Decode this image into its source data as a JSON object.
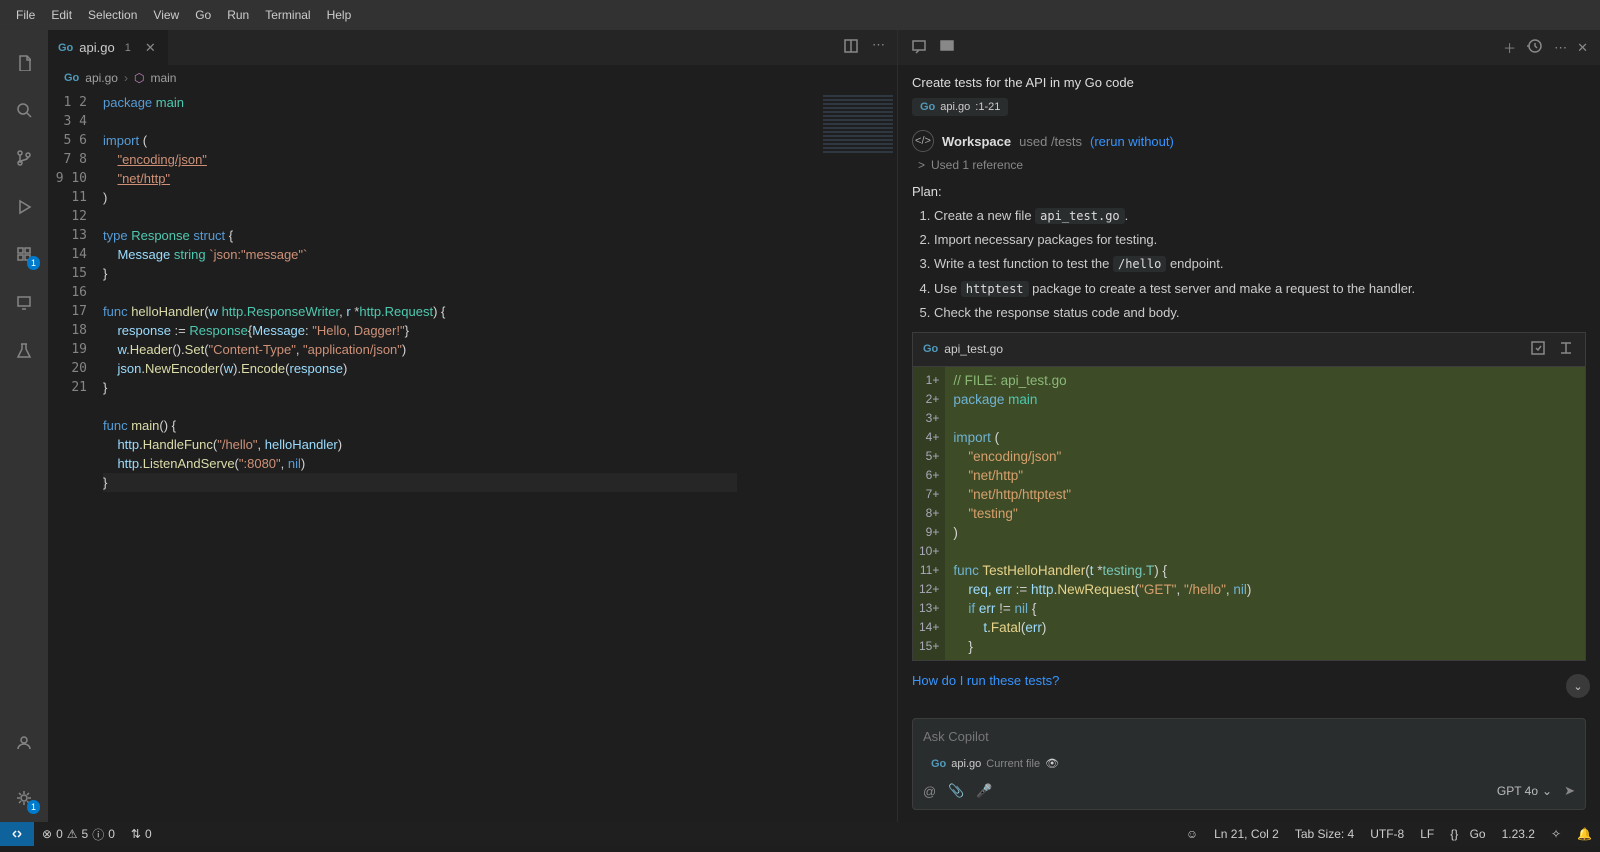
{
  "menubar": [
    "File",
    "Edit",
    "Selection",
    "View",
    "Go",
    "Run",
    "Terminal",
    "Help"
  ],
  "tab": {
    "icon": "go",
    "name": "api.go",
    "dirty": "1"
  },
  "tab_actions": {
    "split": "split-icon",
    "more": "more-icon"
  },
  "breadcrumb": {
    "icon": "go",
    "file": "api.go",
    "sym_icon": "package-icon",
    "sym": "main"
  },
  "editor": {
    "line_count": 21,
    "lines": [
      [
        [
          "kw",
          "package"
        ],
        [
          "sp",
          " "
        ],
        [
          "pkg",
          "main"
        ]
      ],
      [],
      [
        [
          "kw",
          "import"
        ],
        [
          "sp",
          " "
        ],
        [
          "punc",
          "("
        ]
      ],
      [
        [
          "sp",
          "    "
        ],
        [
          "str-u",
          "\"encoding/json\""
        ]
      ],
      [
        [
          "sp",
          "    "
        ],
        [
          "str-u",
          "\"net/http\""
        ]
      ],
      [
        [
          "punc",
          ")"
        ]
      ],
      [],
      [
        [
          "kw",
          "type"
        ],
        [
          "sp",
          " "
        ],
        [
          "type",
          "Response"
        ],
        [
          "sp",
          " "
        ],
        [
          "kw",
          "struct"
        ],
        [
          "sp",
          " "
        ],
        [
          "punc",
          "{"
        ]
      ],
      [
        [
          "sp",
          "    "
        ],
        [
          "id",
          "Message"
        ],
        [
          "sp",
          " "
        ],
        [
          "type",
          "string"
        ],
        [
          "sp",
          " "
        ],
        [
          "tag",
          "`json:\"message\"`"
        ]
      ],
      [
        [
          "punc",
          "}"
        ]
      ],
      [],
      [
        [
          "kw",
          "func"
        ],
        [
          "sp",
          " "
        ],
        [
          "fn",
          "helloHandler"
        ],
        [
          "punc",
          "("
        ],
        [
          "id",
          "w"
        ],
        [
          "sp",
          " "
        ],
        [
          "type",
          "http.ResponseWriter"
        ],
        [
          "punc",
          ", "
        ],
        [
          "id",
          "r"
        ],
        [
          "sp",
          " *"
        ],
        [
          "type",
          "http.Request"
        ],
        [
          "punc",
          ") {"
        ]
      ],
      [
        [
          "sp",
          "    "
        ],
        [
          "id",
          "response"
        ],
        [
          "sp",
          " := "
        ],
        [
          "type",
          "Response"
        ],
        [
          "punc",
          "{"
        ],
        [
          "id",
          "Message"
        ],
        [
          "punc",
          ": "
        ],
        [
          "str",
          "\"Hello, Dagger!\""
        ],
        [
          "punc",
          "}"
        ]
      ],
      [
        [
          "sp",
          "    "
        ],
        [
          "id",
          "w"
        ],
        [
          "punc",
          "."
        ],
        [
          "fn",
          "Header"
        ],
        [
          "punc",
          "()."
        ],
        [
          "fn",
          "Set"
        ],
        [
          "punc",
          "("
        ],
        [
          "str",
          "\"Content-Type\""
        ],
        [
          "punc",
          ", "
        ],
        [
          "str",
          "\"application/json\""
        ],
        [
          "punc",
          ")"
        ]
      ],
      [
        [
          "sp",
          "    "
        ],
        [
          "id",
          "json"
        ],
        [
          "punc",
          "."
        ],
        [
          "fn",
          "NewEncoder"
        ],
        [
          "punc",
          "("
        ],
        [
          "id",
          "w"
        ],
        [
          "punc",
          ")."
        ],
        [
          "fn",
          "Encode"
        ],
        [
          "punc",
          "("
        ],
        [
          "id",
          "response"
        ],
        [
          "punc",
          ")"
        ]
      ],
      [
        [
          "punc",
          "}"
        ]
      ],
      [],
      [
        [
          "kw",
          "func"
        ],
        [
          "sp",
          " "
        ],
        [
          "fn",
          "main"
        ],
        [
          "punc",
          "() {"
        ]
      ],
      [
        [
          "sp",
          "    "
        ],
        [
          "id",
          "http"
        ],
        [
          "punc",
          "."
        ],
        [
          "fn",
          "HandleFunc"
        ],
        [
          "punc",
          "("
        ],
        [
          "str",
          "\"/hello\""
        ],
        [
          "punc",
          ", "
        ],
        [
          "id",
          "helloHandler"
        ],
        [
          "punc",
          ")"
        ]
      ],
      [
        [
          "sp",
          "    "
        ],
        [
          "id",
          "http"
        ],
        [
          "punc",
          "."
        ],
        [
          "fn",
          "ListenAndServe"
        ],
        [
          "punc",
          "("
        ],
        [
          "str",
          "\":8080\""
        ],
        [
          "punc",
          ", "
        ],
        [
          "const",
          "nil"
        ],
        [
          "punc",
          ")"
        ]
      ],
      [
        [
          "punc",
          "}"
        ]
      ]
    ],
    "current_line": 21
  },
  "copilot": {
    "prompt": "Create tests for the API in my Go code",
    "context_chip": {
      "file": "api.go",
      "range": ":1-21"
    },
    "workspace": {
      "label": "Workspace",
      "note": "used /tests",
      "link": "(rerun without)"
    },
    "references": {
      "chev": ">",
      "text": "Used 1 reference"
    },
    "plan_header": "Plan:",
    "plan": [
      {
        "pre": "Create a new file ",
        "code": "api_test.go",
        "post": "."
      },
      {
        "pre": "Import necessary packages for testing.",
        "code": "",
        "post": ""
      },
      {
        "pre": "Write a test function to test the ",
        "code": "/hello",
        "post": " endpoint."
      },
      {
        "pre": "Use ",
        "code": "httptest",
        "post": " package to create a test server and make a request to the handler."
      },
      {
        "pre": "Check the response status code and body.",
        "code": "",
        "post": ""
      }
    ],
    "codeblock": {
      "filename": "api_test.go",
      "lines": [
        {
          "n": "1",
          "mk": "+",
          "tokens": [
            [
              "comment",
              "// FILE: api_test.go"
            ]
          ]
        },
        {
          "n": "2",
          "mk": "+",
          "tokens": [
            [
              "kw",
              "package"
            ],
            [
              "sp",
              " "
            ],
            [
              "pkg",
              "main"
            ]
          ]
        },
        {
          "n": "3",
          "mk": "+",
          "tokens": []
        },
        {
          "n": "4",
          "mk": "+",
          "tokens": [
            [
              "kw",
              "import"
            ],
            [
              "sp",
              " "
            ],
            [
              "punc",
              "("
            ]
          ]
        },
        {
          "n": "5",
          "mk": "+",
          "tokens": [
            [
              "sp",
              "    "
            ],
            [
              "str",
              "\"encoding/json\""
            ]
          ]
        },
        {
          "n": "6",
          "mk": "+",
          "tokens": [
            [
              "sp",
              "    "
            ],
            [
              "str",
              "\"net/http\""
            ]
          ]
        },
        {
          "n": "7",
          "mk": "+",
          "tokens": [
            [
              "sp",
              "    "
            ],
            [
              "str",
              "\"net/http/httptest\""
            ]
          ]
        },
        {
          "n": "8",
          "mk": "+",
          "tokens": [
            [
              "sp",
              "    "
            ],
            [
              "str",
              "\"testing\""
            ]
          ]
        },
        {
          "n": "9",
          "mk": "+",
          "tokens": [
            [
              "punc",
              ")"
            ]
          ]
        },
        {
          "n": "10",
          "mk": "+",
          "tokens": []
        },
        {
          "n": "11",
          "mk": "+",
          "tokens": [
            [
              "kw",
              "func"
            ],
            [
              "sp",
              " "
            ],
            [
              "fn",
              "TestHelloHandler"
            ],
            [
              "punc",
              "("
            ],
            [
              "id",
              "t"
            ],
            [
              "sp",
              " *"
            ],
            [
              "type",
              "testing.T"
            ],
            [
              "punc",
              ") {"
            ]
          ]
        },
        {
          "n": "12",
          "mk": "+",
          "tokens": [
            [
              "sp",
              "    "
            ],
            [
              "id",
              "req"
            ],
            [
              "punc",
              ", "
            ],
            [
              "id",
              "err"
            ],
            [
              "sp",
              " := "
            ],
            [
              "id",
              "http"
            ],
            [
              "punc",
              "."
            ],
            [
              "fn",
              "NewRequest"
            ],
            [
              "punc",
              "("
            ],
            [
              "str",
              "\"GET\""
            ],
            [
              "punc",
              ", "
            ],
            [
              "str",
              "\"/hello\""
            ],
            [
              "punc",
              ", "
            ],
            [
              "const",
              "nil"
            ],
            [
              "punc",
              ")"
            ]
          ]
        },
        {
          "n": "13",
          "mk": "+",
          "tokens": [
            [
              "sp",
              "    "
            ],
            [
              "kw",
              "if"
            ],
            [
              "sp",
              " "
            ],
            [
              "id",
              "err"
            ],
            [
              "sp",
              " != "
            ],
            [
              "const",
              "nil"
            ],
            [
              "sp",
              " "
            ],
            [
              "punc",
              "{"
            ]
          ]
        },
        {
          "n": "14",
          "mk": "+",
          "tokens": [
            [
              "sp",
              "        "
            ],
            [
              "id",
              "t"
            ],
            [
              "punc",
              "."
            ],
            [
              "fn",
              "Fatal"
            ],
            [
              "punc",
              "("
            ],
            [
              "id",
              "err"
            ],
            [
              "punc",
              ")"
            ]
          ]
        },
        {
          "n": "15",
          "mk": "+",
          "tokens": [
            [
              "sp",
              "    "
            ],
            [
              "punc",
              "}"
            ]
          ]
        }
      ]
    },
    "followup": "How do I run these tests?",
    "input_placeholder": "Ask Copilot",
    "input_chip": {
      "file": "api.go",
      "scope": "Current file"
    },
    "model": "GPT 4o"
  },
  "statusbar": {
    "left": {
      "errors": "0",
      "warnings": "5",
      "warn_icon": "⚠",
      "err_icon": "⊗",
      "info": "0",
      "ports_icon": "⇅",
      "ports": "0"
    },
    "right": {
      "cursor": "Ln 21, Col 2",
      "tabsize": "Tab Size: 4",
      "encoding": "UTF-8",
      "eol": "LF",
      "lang_icon": "{}",
      "lang": "Go",
      "version": "1.23.2",
      "feedback": "⌖",
      "bell": "🔔"
    }
  },
  "activity_badges": {
    "extensions": "1",
    "settings": "1"
  }
}
